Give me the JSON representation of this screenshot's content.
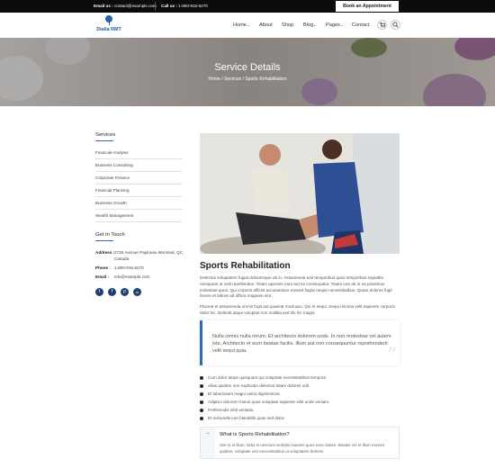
{
  "topbar": {
    "email_label": "Email us :",
    "email": "contact@example.com",
    "call_label": "Call us :",
    "phone": "1-800-915-6270",
    "appointment_button": "Book an Appointment"
  },
  "brand": {
    "name": "Dialia RMT",
    "color": "#1f5fa0"
  },
  "nav": {
    "items": [
      "Home",
      "About",
      "Shop",
      "Blog",
      "Pages",
      "Contact"
    ],
    "dropdown_marker": "⌄",
    "cart_icon": "cart-icon",
    "search_icon": "search-icon"
  },
  "hero": {
    "title": "Service Details",
    "breadcrumb": [
      "Home",
      "Services",
      "Sports Rehabilitation"
    ],
    "separator": "/"
  },
  "sidebar": {
    "services_heading": "Services",
    "services": [
      "Financial Analysis",
      "Business Consulting",
      "Corporate Finance",
      "Financial Planning",
      "Business Growth",
      "Wealth Management"
    ],
    "contact_heading": "Get In Touch",
    "contact": {
      "address_label": "Address :",
      "address_line1": "2726 Avenue Papineau Montreal, QC,",
      "address_line2": "Canada",
      "phone_label": "Phone :",
      "phone": "1-800-915-6270",
      "email_label": "Email :",
      "email": "info@example.com"
    },
    "social": [
      {
        "icon": "twitter-icon",
        "glyph": "t"
      },
      {
        "icon": "facebook-icon",
        "glyph": "f"
      },
      {
        "icon": "pinterest-icon",
        "glyph": "p"
      },
      {
        "icon": "linkedin-icon",
        "glyph": "in"
      }
    ]
  },
  "main": {
    "title": "Sports Rehabilitation",
    "paragraph1": "Delectus voluptatem fugiat doloremque ab in. Assumenda eos temporibus quos temporibus expedita numquam ut velit repellendus. Totam aperiam eum aut ex consequatur. Totam iure ab in ea possimus molestiae quos. Qui corporis officiis accusantium eveniet fugiat neque necessitatibus. Quam dolores fugit facere et labore ad officia magnam sint.",
    "paragraph2": "Placeat et assumenda omnis fugit aut quaerat modi quo. Qui et sequi. Sequi minima velit sapiente corporis dolor hic. Deleniti atque voluptas non mollitia sed illo hic magni.",
    "quote": "Nulla omnis nulla rerum. Et architecto dolorem unde. In non molestiae vel autem iste. Architecto et eum beatae facilis. Illum aut non consequuntur reprehenderit velit sequi quia.",
    "bullets": [
      "Cum dolor atque quisquam qui voluptate necessitatibus tempore.",
      "Alias quidem non explicabo delectus totam dolores odit.",
      "Et laboriosam magni animi dignissimos.",
      "Adipisci dolorem minus quos voluptate sapiente velit unde veniam.",
      "Perferendis nihil veritatis.",
      "Et reiciendis iure blanditiis quas sed dolor."
    ],
    "faq": [
      {
        "toggle": "−",
        "question": "What is Sports Rehabilitation?",
        "answer": "Sint et et illum. Odio et nesciunt veritatis maxime quos esse dolore. Beatae vel et illum eveniet quidem, voluptate sed necessitatibus ut voluptatem deleniti."
      }
    ]
  },
  "colors": {
    "accent": "#2d6cb8",
    "topbar": "#0b0b0b",
    "social": "#1f3f6e"
  }
}
